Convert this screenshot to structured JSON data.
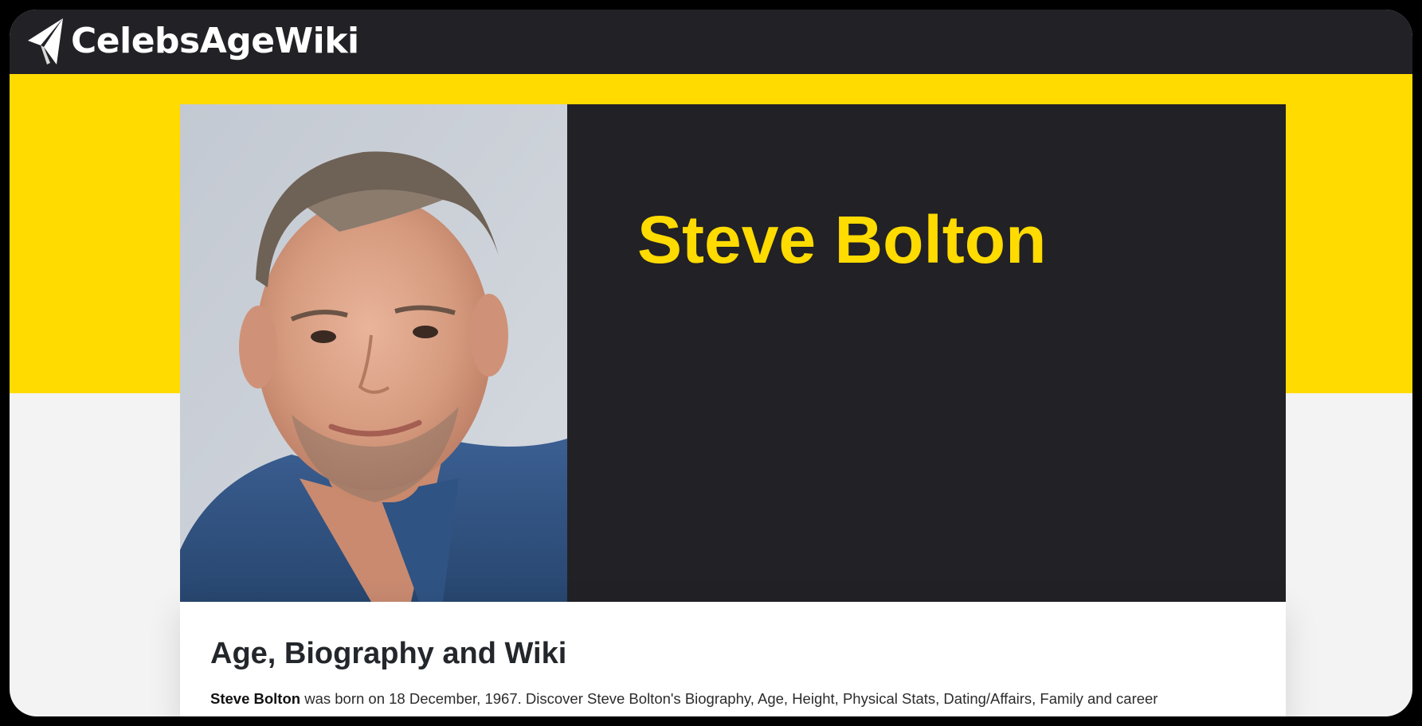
{
  "header": {
    "logo_text": "CelebsAgeWiki",
    "logo_icon": "paper-plane-icon"
  },
  "hero": {
    "name": "Steve Bolton",
    "photo_alt": "Steve Bolton"
  },
  "content": {
    "heading": "Age, Biography and Wiki",
    "intro_name": "Steve Bolton",
    "intro_text": " was born on 18 December, 1967. Discover Steve Bolton's Biography, Age, Height, Physical Stats, Dating/Affairs, Family and career"
  },
  "colors": {
    "brand_yellow": "#ffdb00",
    "dark": "#222126",
    "page_bg": "#f3f3f3",
    "card_bg": "#ffffff"
  }
}
